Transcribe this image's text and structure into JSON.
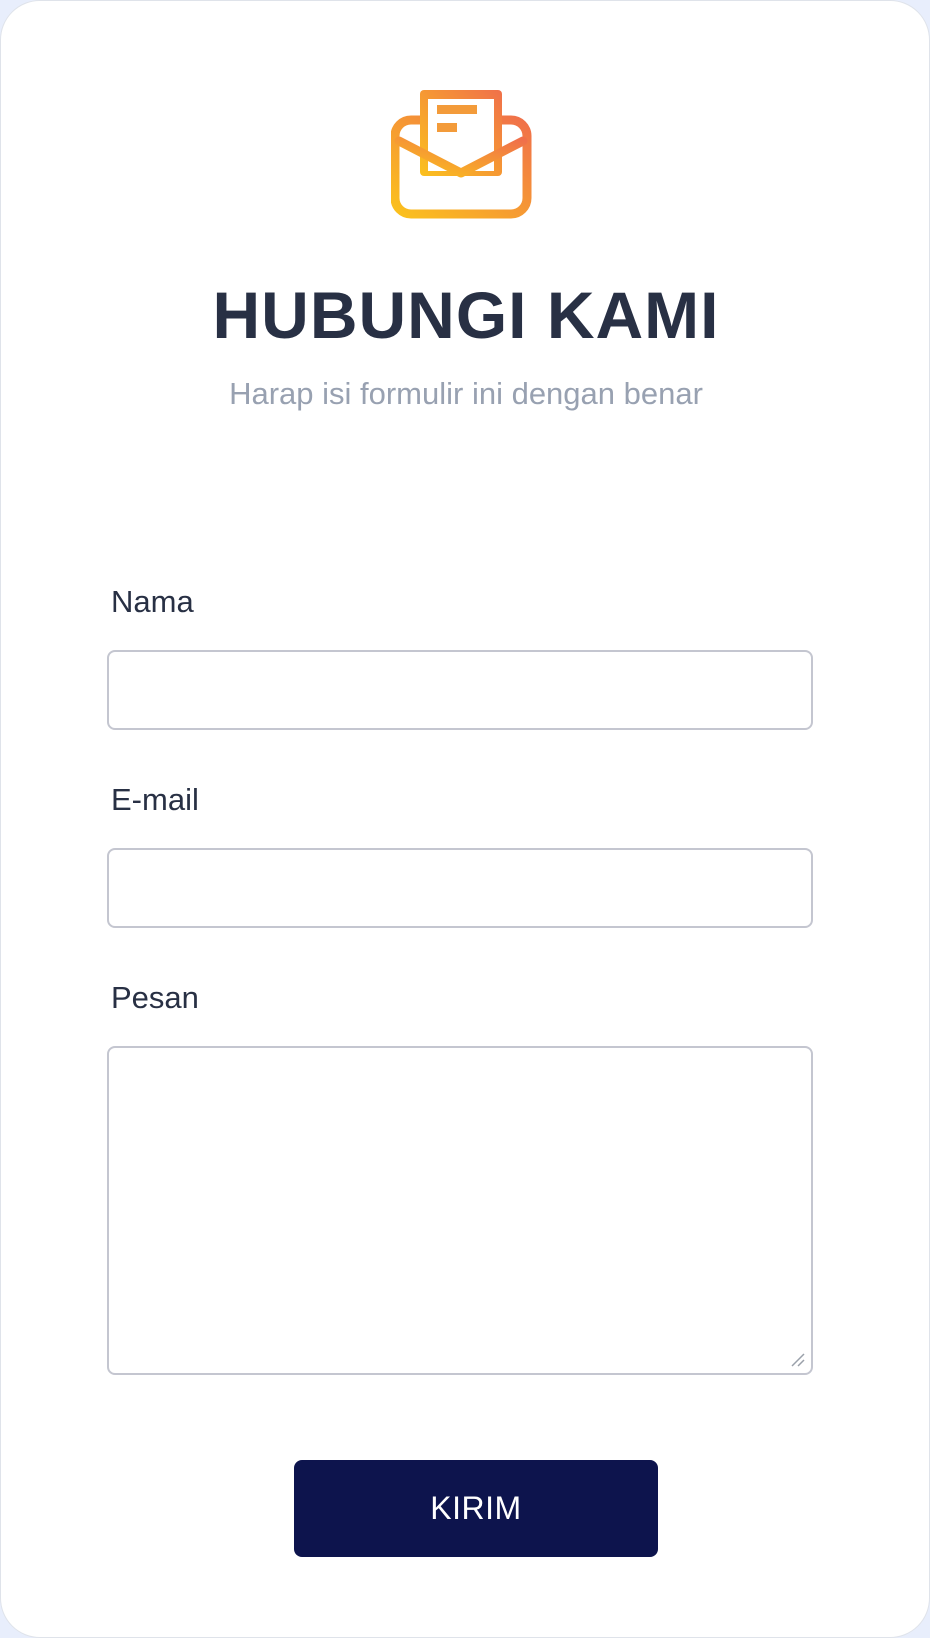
{
  "header": {
    "icon": "mail-open-icon",
    "title": "HUBUNGI KAMI",
    "subtitle": "Harap isi formulir ini dengan benar"
  },
  "form": {
    "name_label": "Nama",
    "name_value": "",
    "email_label": "E-mail",
    "email_value": "",
    "message_label": "Pesan",
    "message_value": "",
    "submit_label": "KIRIM"
  },
  "colors": {
    "page_background": "#e8eefc",
    "card_background": "#ffffff",
    "heading": "#283044",
    "subtitle": "#98a1b1",
    "field_border": "#c4c6d0",
    "button": "#0d144d",
    "icon_gradient_start": "#fbc11d",
    "icon_gradient_end": "#f0704a"
  }
}
